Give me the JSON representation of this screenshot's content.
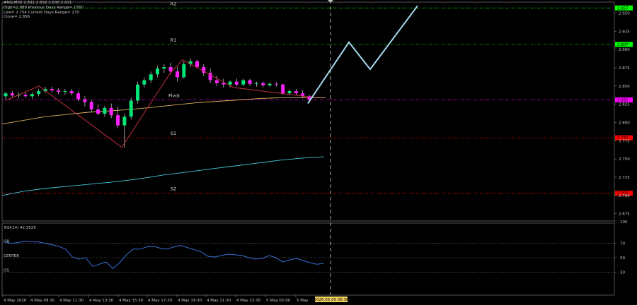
{
  "header": {
    "line1": "#NG,M30  2.831 2.832 2.830 2.831",
    "line2": "High=2.888   Previous Days Range= 1560",
    "line3": "Low= 2.754   Current Days Range= 270",
    "line4": "Close= 2.856"
  },
  "levels": {
    "r2": {
      "label": "R2",
      "price": 2.957,
      "price_label": "2.957",
      "color": "#00ff00"
    },
    "r1": {
      "label": "R1",
      "price": 2.907,
      "price_label": "2.907",
      "color": "#00ff00"
    },
    "pivot": {
      "label": "Pivot",
      "price": 2.831,
      "price_label": "2.831",
      "color": "#ff00ff"
    },
    "s1": {
      "label": "S1",
      "price": 2.779,
      "price_label": "2.779",
      "color": "#ff0000"
    },
    "s2": {
      "label": "S2",
      "price": 2.703,
      "price_label": "2.703",
      "color": "#ff0000"
    }
  },
  "price_axis": {
    "ticks": [
      "2.950",
      "2.925",
      "2.900",
      "2.875",
      "2.850",
      "2.825",
      "2.800",
      "2.775",
      "2.750",
      "2.725",
      "2.700",
      "2.675"
    ],
    "tick_values": [
      2.95,
      2.925,
      2.9,
      2.875,
      2.85,
      2.825,
      2.8,
      2.775,
      2.75,
      2.725,
      2.7,
      2.675
    ]
  },
  "time_axis": {
    "labels": [
      "4 May 2026",
      "4 May 09:30",
      "4 May 11:30",
      "4 May 13:30",
      "4 May 15:30",
      "4 May 17:30",
      "4 May 19:30",
      "4 May 21:30",
      "4 May 23:30",
      "5 May 02:00",
      "5 May"
    ],
    "crosshair_label": "2026.05.05 06:30"
  },
  "rsi": {
    "title": "RSI(14) 42.3529",
    "levels": [
      {
        "label": "OB",
        "value": 70
      },
      {
        "label": "CENTER",
        "value": 50
      },
      {
        "label": "OS",
        "value": 30
      }
    ],
    "axis_ticks": [
      "100",
      "70",
      "50",
      "30"
    ],
    "axis_values": [
      100,
      70,
      50,
      30
    ],
    "line_color": "#3a6fd8",
    "values": [
      72,
      70,
      71,
      73,
      72,
      72,
      70,
      68,
      66,
      62,
      51,
      48,
      50,
      38,
      41,
      44,
      35,
      43,
      54,
      62,
      62,
      65,
      66,
      63,
      62,
      65,
      67,
      64,
      61,
      58,
      52,
      51,
      53,
      55,
      54,
      53,
      50,
      48,
      49,
      53,
      50,
      44,
      47,
      49,
      46,
      43,
      41,
      42
    ]
  },
  "candles": [
    {
      "o": 2.836,
      "h": 2.842,
      "l": 2.832,
      "c": 2.84
    },
    {
      "o": 2.84,
      "h": 2.843,
      "l": 2.835,
      "c": 2.837
    },
    {
      "o": 2.837,
      "h": 2.841,
      "l": 2.833,
      "c": 2.838
    },
    {
      "o": 2.838,
      "h": 2.842,
      "l": 2.834,
      "c": 2.836
    },
    {
      "o": 2.836,
      "h": 2.841,
      "l": 2.832,
      "c": 2.839
    },
    {
      "o": 2.839,
      "h": 2.846,
      "l": 2.836,
      "c": 2.843
    },
    {
      "o": 2.843,
      "h": 2.849,
      "l": 2.84,
      "c": 2.846
    },
    {
      "o": 2.846,
      "h": 2.849,
      "l": 2.841,
      "c": 2.844
    },
    {
      "o": 2.844,
      "h": 2.847,
      "l": 2.839,
      "c": 2.842
    },
    {
      "o": 2.842,
      "h": 2.846,
      "l": 2.838,
      "c": 2.843
    },
    {
      "o": 2.843,
      "h": 2.846,
      "l": 2.837,
      "c": 2.84
    },
    {
      "o": 2.84,
      "h": 2.843,
      "l": 2.829,
      "c": 2.832
    },
    {
      "o": 2.832,
      "h": 2.836,
      "l": 2.822,
      "c": 2.828
    },
    {
      "o": 2.828,
      "h": 2.831,
      "l": 2.815,
      "c": 2.818
    },
    {
      "o": 2.818,
      "h": 2.825,
      "l": 2.81,
      "c": 2.812
    },
    {
      "o": 2.812,
      "h": 2.823,
      "l": 2.808,
      "c": 2.82
    },
    {
      "o": 2.82,
      "h": 2.826,
      "l": 2.806,
      "c": 2.81
    },
    {
      "o": 2.81,
      "h": 2.822,
      "l": 2.792,
      "c": 2.796
    },
    {
      "o": 2.796,
      "h": 2.812,
      "l": 2.765,
      "c": 2.808
    },
    {
      "o": 2.808,
      "h": 2.834,
      "l": 2.804,
      "c": 2.83
    },
    {
      "o": 2.83,
      "h": 2.856,
      "l": 2.826,
      "c": 2.852
    },
    {
      "o": 2.852,
      "h": 2.862,
      "l": 2.848,
      "c": 2.858
    },
    {
      "o": 2.858,
      "h": 2.87,
      "l": 2.854,
      "c": 2.866
    },
    {
      "o": 2.866,
      "h": 2.878,
      "l": 2.862,
      "c": 2.874
    },
    {
      "o": 2.874,
      "h": 2.88,
      "l": 2.868,
      "c": 2.876
    },
    {
      "o": 2.876,
      "h": 2.882,
      "l": 2.866,
      "c": 2.87
    },
    {
      "o": 2.87,
      "h": 2.876,
      "l": 2.856,
      "c": 2.862
    },
    {
      "o": 2.862,
      "h": 2.884,
      "l": 2.86,
      "c": 2.88
    },
    {
      "o": 2.88,
      "h": 2.888,
      "l": 2.876,
      "c": 2.884
    },
    {
      "o": 2.884,
      "h": 2.886,
      "l": 2.874,
      "c": 2.876
    },
    {
      "o": 2.876,
      "h": 2.88,
      "l": 2.864,
      "c": 2.868
    },
    {
      "o": 2.868,
      "h": 2.874,
      "l": 2.854,
      "c": 2.858
    },
    {
      "o": 2.858,
      "h": 2.864,
      "l": 2.85,
      "c": 2.854
    },
    {
      "o": 2.854,
      "h": 2.86,
      "l": 2.848,
      "c": 2.852
    },
    {
      "o": 2.852,
      "h": 2.858,
      "l": 2.848,
      "c": 2.856
    },
    {
      "o": 2.856,
      "h": 2.86,
      "l": 2.85,
      "c": 2.852
    },
    {
      "o": 2.852,
      "h": 2.86,
      "l": 2.85,
      "c": 2.858
    },
    {
      "o": 2.858,
      "h": 2.86,
      "l": 2.85,
      "c": 2.853
    },
    {
      "o": 2.853,
      "h": 2.856,
      "l": 2.849,
      "c": 2.854
    },
    {
      "o": 2.854,
      "h": 2.856,
      "l": 2.848,
      "c": 2.851
    },
    {
      "o": 2.851,
      "h": 2.855,
      "l": 2.849,
      "c": 2.853
    },
    {
      "o": 2.853,
      "h": 2.855,
      "l": 2.849,
      "c": 2.852
    },
    {
      "o": 2.852,
      "h": 2.853,
      "l": 2.838,
      "c": 2.84
    },
    {
      "o": 2.84,
      "h": 2.845,
      "l": 2.837,
      "c": 2.843
    },
    {
      "o": 2.843,
      "h": 2.846,
      "l": 2.838,
      "c": 2.84
    },
    {
      "o": 2.84,
      "h": 2.844,
      "l": 2.834,
      "c": 2.836
    },
    {
      "o": 2.836,
      "h": 2.838,
      "l": 2.828,
      "c": 2.831
    }
  ],
  "ma_slow": {
    "color": "#e0b060",
    "values": [
      2.798,
      2.803,
      2.808,
      2.811,
      2.814,
      2.816,
      2.818,
      2.821,
      2.824,
      2.827,
      2.829,
      2.831,
      2.833,
      2.834,
      2.834,
      2.834
    ]
  },
  "ma_long": {
    "color": "#40c8d8",
    "values": [
      2.7,
      2.706,
      2.71,
      2.713,
      2.716,
      2.719,
      2.723,
      2.728,
      2.732,
      2.736,
      2.74,
      2.744,
      2.748,
      2.751,
      2.753
    ]
  },
  "zigzag": {
    "color": "#c03040",
    "values": [
      2.83,
      2.85,
      2.766,
      2.867,
      2.886,
      2.848,
      2.835
    ]
  },
  "forecast": {
    "color": "#a8d8f0",
    "values": [
      2.826,
      2.91,
      2.873,
      2.96
    ]
  },
  "colors": {
    "bull": "#00e676",
    "bear": "#ff20ff",
    "grid": "#222",
    "axis": "#c8c8c8"
  }
}
